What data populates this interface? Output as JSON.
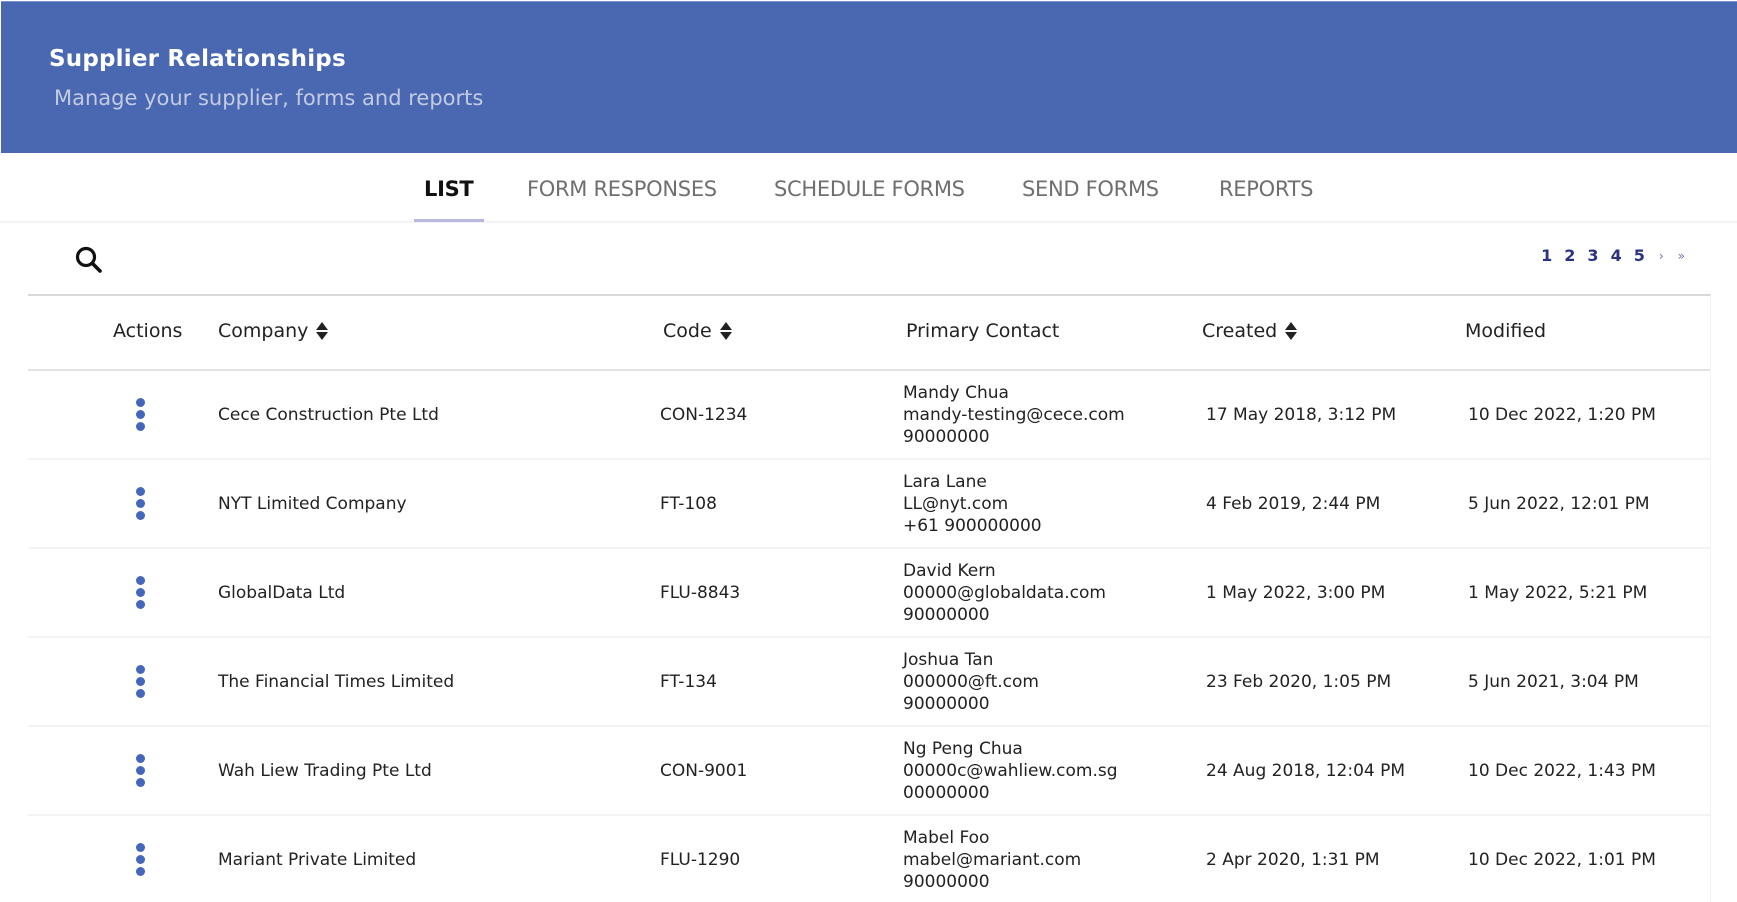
{
  "header": {
    "title": "Supplier Relationships",
    "subtitle": "Manage your supplier, forms and reports",
    "background_color": "#4a68b1"
  },
  "tabs": [
    {
      "label": "LIST",
      "active": true
    },
    {
      "label": "FORM RESPONSES",
      "active": false
    },
    {
      "label": "SCHEDULE FORMS",
      "active": false
    },
    {
      "label": "SEND FORMS",
      "active": false
    },
    {
      "label": "REPORTS",
      "active": false
    }
  ],
  "toolbar": {
    "search_icon": "search-icon"
  },
  "pagination": {
    "pages": [
      "1",
      "2",
      "3",
      "4",
      "5"
    ],
    "next": "›",
    "last": "»",
    "color": "#2b3280"
  },
  "table": {
    "columns": [
      {
        "label": "Actions",
        "sortable": false
      },
      {
        "label": "Company",
        "sortable": true
      },
      {
        "label": "Code",
        "sortable": true
      },
      {
        "label": "Primary Contact",
        "sortable": false
      },
      {
        "label": "Created",
        "sortable": true
      },
      {
        "label": "Modified",
        "sortable": false
      }
    ],
    "action_icon": "kebab-menu-icon",
    "action_color": "#4467bd",
    "rows": [
      {
        "company": "Cece Construction Pte Ltd",
        "code": "CON-1234",
        "contact": {
          "name": "Mandy Chua",
          "email": "mandy-testing@cece.com",
          "phone": "90000000"
        },
        "created": "17 May 2018, 3:12 PM",
        "modified": "10 Dec 2022, 1:20 PM"
      },
      {
        "company": "NYT Limited Company",
        "code": "FT-108",
        "contact": {
          "name": "Lara Lane",
          "email": "LL@nyt.com",
          "phone": "+61 900000000"
        },
        "created": "4 Feb 2019, 2:44 PM",
        "modified": "5 Jun 2022, 12:01 PM"
      },
      {
        "company": "GlobalData Ltd",
        "code": "FLU-8843",
        "contact": {
          "name": "David Kern",
          "email": "00000@globaldata.com",
          "phone": "90000000"
        },
        "created": "1 May 2022, 3:00 PM",
        "modified": "1 May 2022, 5:21 PM"
      },
      {
        "company": "The Financial Times Limited",
        "code": "FT-134",
        "contact": {
          "name": "Joshua Tan",
          "email": "000000@ft.com",
          "phone": "90000000"
        },
        "created": "23 Feb 2020, 1:05 PM",
        "modified": "5 Jun 2021, 3:04 PM"
      },
      {
        "company": "Wah Liew Trading Pte Ltd",
        "code": "CON-9001",
        "contact": {
          "name": "Ng Peng Chua",
          "email": "00000c@wahliew.com.sg",
          "phone": "00000000"
        },
        "created": "24 Aug 2018, 12:04 PM",
        "modified": "10 Dec 2022, 1:43 PM"
      },
      {
        "company": "Mariant Private Limited",
        "code": "FLU-1290",
        "contact": {
          "name": "Mabel Foo",
          "email": "mabel@mariant.com",
          "phone": "90000000"
        },
        "created": "2 Apr 2020, 1:31 PM",
        "modified": "10 Dec 2022, 1:01 PM"
      }
    ]
  }
}
